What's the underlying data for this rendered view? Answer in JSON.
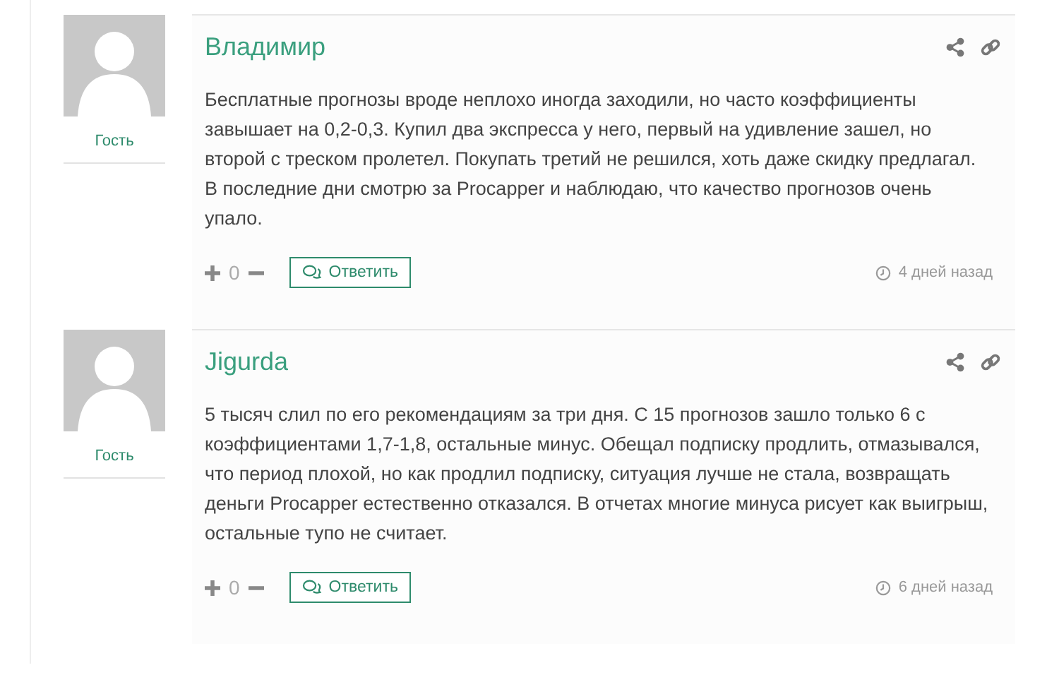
{
  "comments": [
    {
      "author": "Владимир",
      "role": "Гость",
      "text": "Бесплатные прогнозы вроде неплохо иногда заходили, но часто коэффициенты завышает на 0,2-0,3. Купил два экспресса у него, первый на удивление зашел, но второй с треском пролетел. Покупать третий не решился, хоть даже скидку предлагал. В последние дни смотрю за Procapper и наблюдаю, что качество прогнозов очень упало.",
      "votes": "0",
      "reply": "Ответить",
      "time": "4 дней назад"
    },
    {
      "author": "Jigurda",
      "role": "Гость",
      "text": "5 тысяч слил по его рекомендациям за три дня. С 15 прогнозов зашло только 6 с коэффициентами 1,7-1,8, остальные минус. Обещал подписку продлить, отмазывался, что период плохой, но как продлил подписку, ситуация лучше не стала, возвращать деньги Procapper естественно отказался. В отчетах многие минуса рисует как выигрыш, остальные тупо не считает.",
      "votes": "0",
      "reply": "Ответить",
      "time": "6 дней назад"
    }
  ]
}
